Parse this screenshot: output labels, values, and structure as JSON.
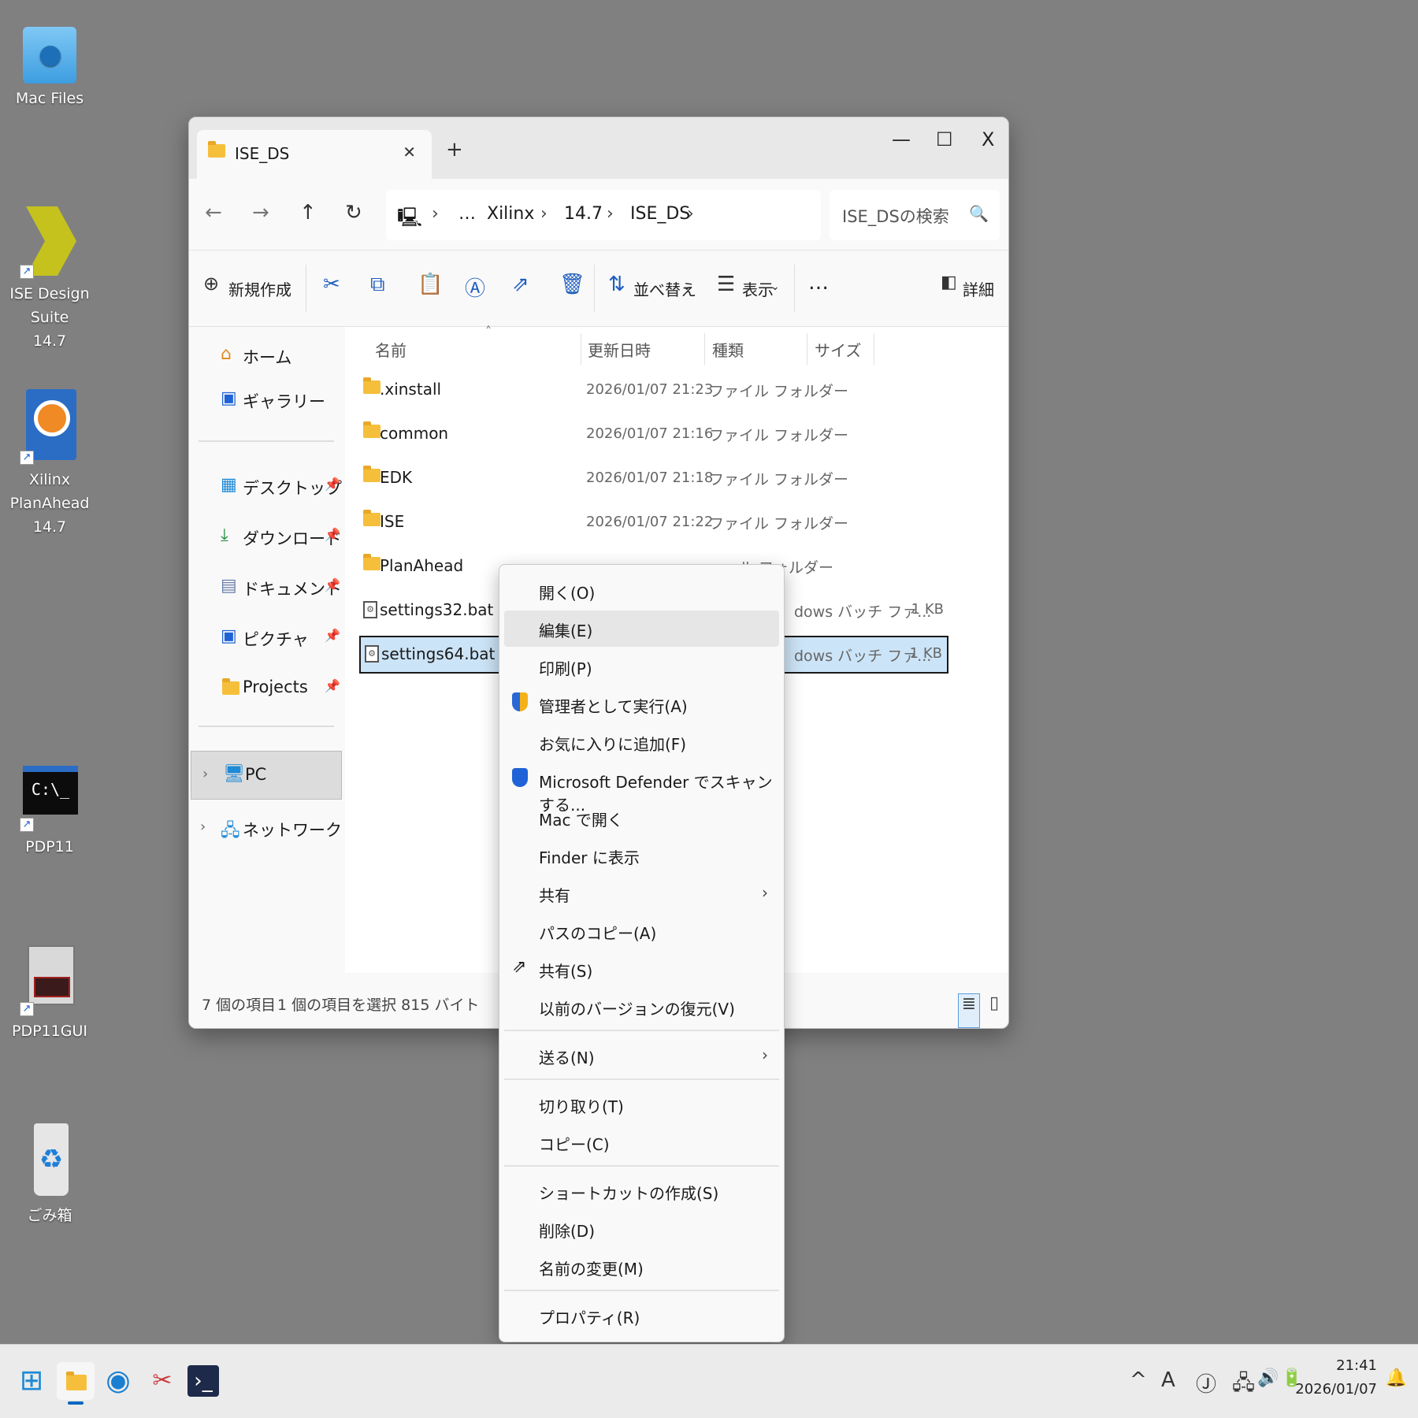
{
  "desktop": {
    "icons": [
      {
        "label": "Mac Files",
        "icon": "mac-folder-icon"
      },
      {
        "label": "ISE Design Suite\n14.7",
        "icon": "xilinx-ise-icon"
      },
      {
        "label": "Xilinx PlanAhead\n14.7",
        "icon": "planahead-icon"
      },
      {
        "label": "PDP11",
        "icon": "cmd-icon",
        "cmd_text": "C:\\_"
      },
      {
        "label": "PDP11GUI",
        "icon": "pdp11gui-icon"
      },
      {
        "label": "ごみ箱",
        "icon": "recycle-bin-icon"
      }
    ]
  },
  "explorer": {
    "tab_title": "ISE_DS",
    "window_controls": {
      "minimize": "—",
      "maximize": "☐",
      "close": "X"
    },
    "breadcrumb": [
      "…",
      "Xilinx",
      "14.7",
      "ISE_DS"
    ],
    "search_placeholder": "ISE_DSの検索",
    "toolbar": {
      "new_label": "新規作成",
      "sort_label": "並べ替え",
      "view_label": "表示",
      "more_label": "…",
      "details_label": "詳細"
    },
    "sidebar": {
      "quick": [
        {
          "label": "ホーム",
          "icon": "home-icon"
        },
        {
          "label": "ギャラリー",
          "icon": "gallery-icon"
        }
      ],
      "pinned": [
        {
          "label": "デスクトップ",
          "icon": "desktop-icon"
        },
        {
          "label": "ダウンロード",
          "icon": "download-icon"
        },
        {
          "label": "ドキュメント",
          "icon": "documents-icon"
        },
        {
          "label": "ピクチャ",
          "icon": "pictures-icon"
        },
        {
          "label": "Projects",
          "icon": "folder-icon"
        }
      ],
      "locations": [
        {
          "label": "PC",
          "icon": "pc-icon"
        },
        {
          "label": "ネットワーク",
          "icon": "network-icon"
        }
      ]
    },
    "columns": {
      "name": "名前",
      "modified": "更新日時",
      "type": "種類",
      "size": "サイズ"
    },
    "files": [
      {
        "name": ".xinstall",
        "modified": "2026/01/07 21:23",
        "type": "ファイル フォルダー",
        "size": "",
        "kind": "folder"
      },
      {
        "name": "common",
        "modified": "2026/01/07 21:16",
        "type": "ファイル フォルダー",
        "size": "",
        "kind": "folder"
      },
      {
        "name": "EDK",
        "modified": "2026/01/07 21:18",
        "type": "ファイル フォルダー",
        "size": "",
        "kind": "folder"
      },
      {
        "name": "ISE",
        "modified": "2026/01/07 21:22",
        "type": "ファイル フォルダー",
        "size": "",
        "kind": "folder"
      },
      {
        "name": "PlanAhead",
        "modified": "",
        "type": "ル フォルダー",
        "size": "",
        "kind": "folder"
      },
      {
        "name": "settings32.bat",
        "modified": "",
        "type": "dows バッチ ファ...",
        "size": "1 KB",
        "kind": "bat"
      },
      {
        "name": "settings64.bat",
        "modified": "",
        "type": "dows バッチ ファ...",
        "size": "1 KB",
        "kind": "bat"
      }
    ],
    "status": {
      "count": "7 個の項目",
      "selected": "1 個の項目を選択 815 バイト"
    }
  },
  "context_menu": {
    "group1": [
      "開く(O)",
      "編集(E)",
      "印刷(P)",
      "管理者として実行(A)",
      "お気に入りに追加(F)",
      "Microsoft Defender でスキャンする...",
      "Mac で開く",
      "Finder に表示",
      "共有",
      "パスのコピー(A)",
      "共有(S)",
      "以前のバージョンの復元(V)"
    ],
    "group2": [
      "送る(N)"
    ],
    "group3": [
      "切り取り(T)",
      "コピー(C)"
    ],
    "group4": [
      "ショートカットの作成(S)",
      "削除(D)",
      "名前の変更(M)"
    ],
    "group5": [
      "プロパティ(R)"
    ]
  },
  "taskbar": {
    "clock_time": "21:41",
    "clock_date": "2026/01/07",
    "ime": "A"
  },
  "colors": {
    "accent": "#0067c0",
    "selection": "#cce4f7",
    "folder": "#f6bf3b"
  }
}
